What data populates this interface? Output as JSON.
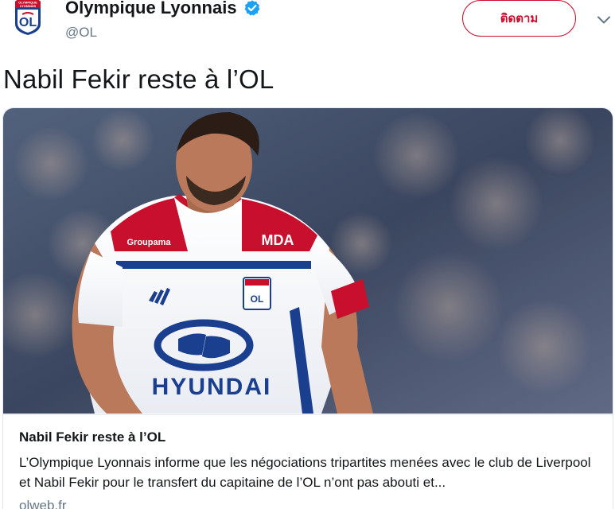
{
  "account": {
    "display_name": "Olympique Lyonnais",
    "handle": "@OL",
    "verified": true,
    "avatar_icon": "ol-crest-icon",
    "avatar_text_top": "OLYMPIQUE",
    "avatar_text_mid": "LYONNAIS",
    "avatar_text_monogram": "OL"
  },
  "actions": {
    "follow_label": "ติดตาม",
    "more_icon": "chevron-down-icon"
  },
  "tweet": {
    "text": "Nabil Fekir reste à l’OL"
  },
  "card": {
    "image_icon": "player-photo",
    "title": "Nabil Fekir reste à l’OL",
    "description": "L’Olympique Lyonnais informe que les négociations tripartites menées avec le club de Liverpool et Nabil Fekir pour le transfert du capitaine de l’OL n’ont pas abouti et...",
    "domain": "olweb.fr",
    "jersey_sponsor": "HYUNDAI",
    "jersey_sleeve": "Groupama",
    "jersey_chest": "MDA"
  },
  "colors": {
    "accent": "#c8102e",
    "verified": "#1da1f2",
    "secondary_text": "#657786"
  }
}
